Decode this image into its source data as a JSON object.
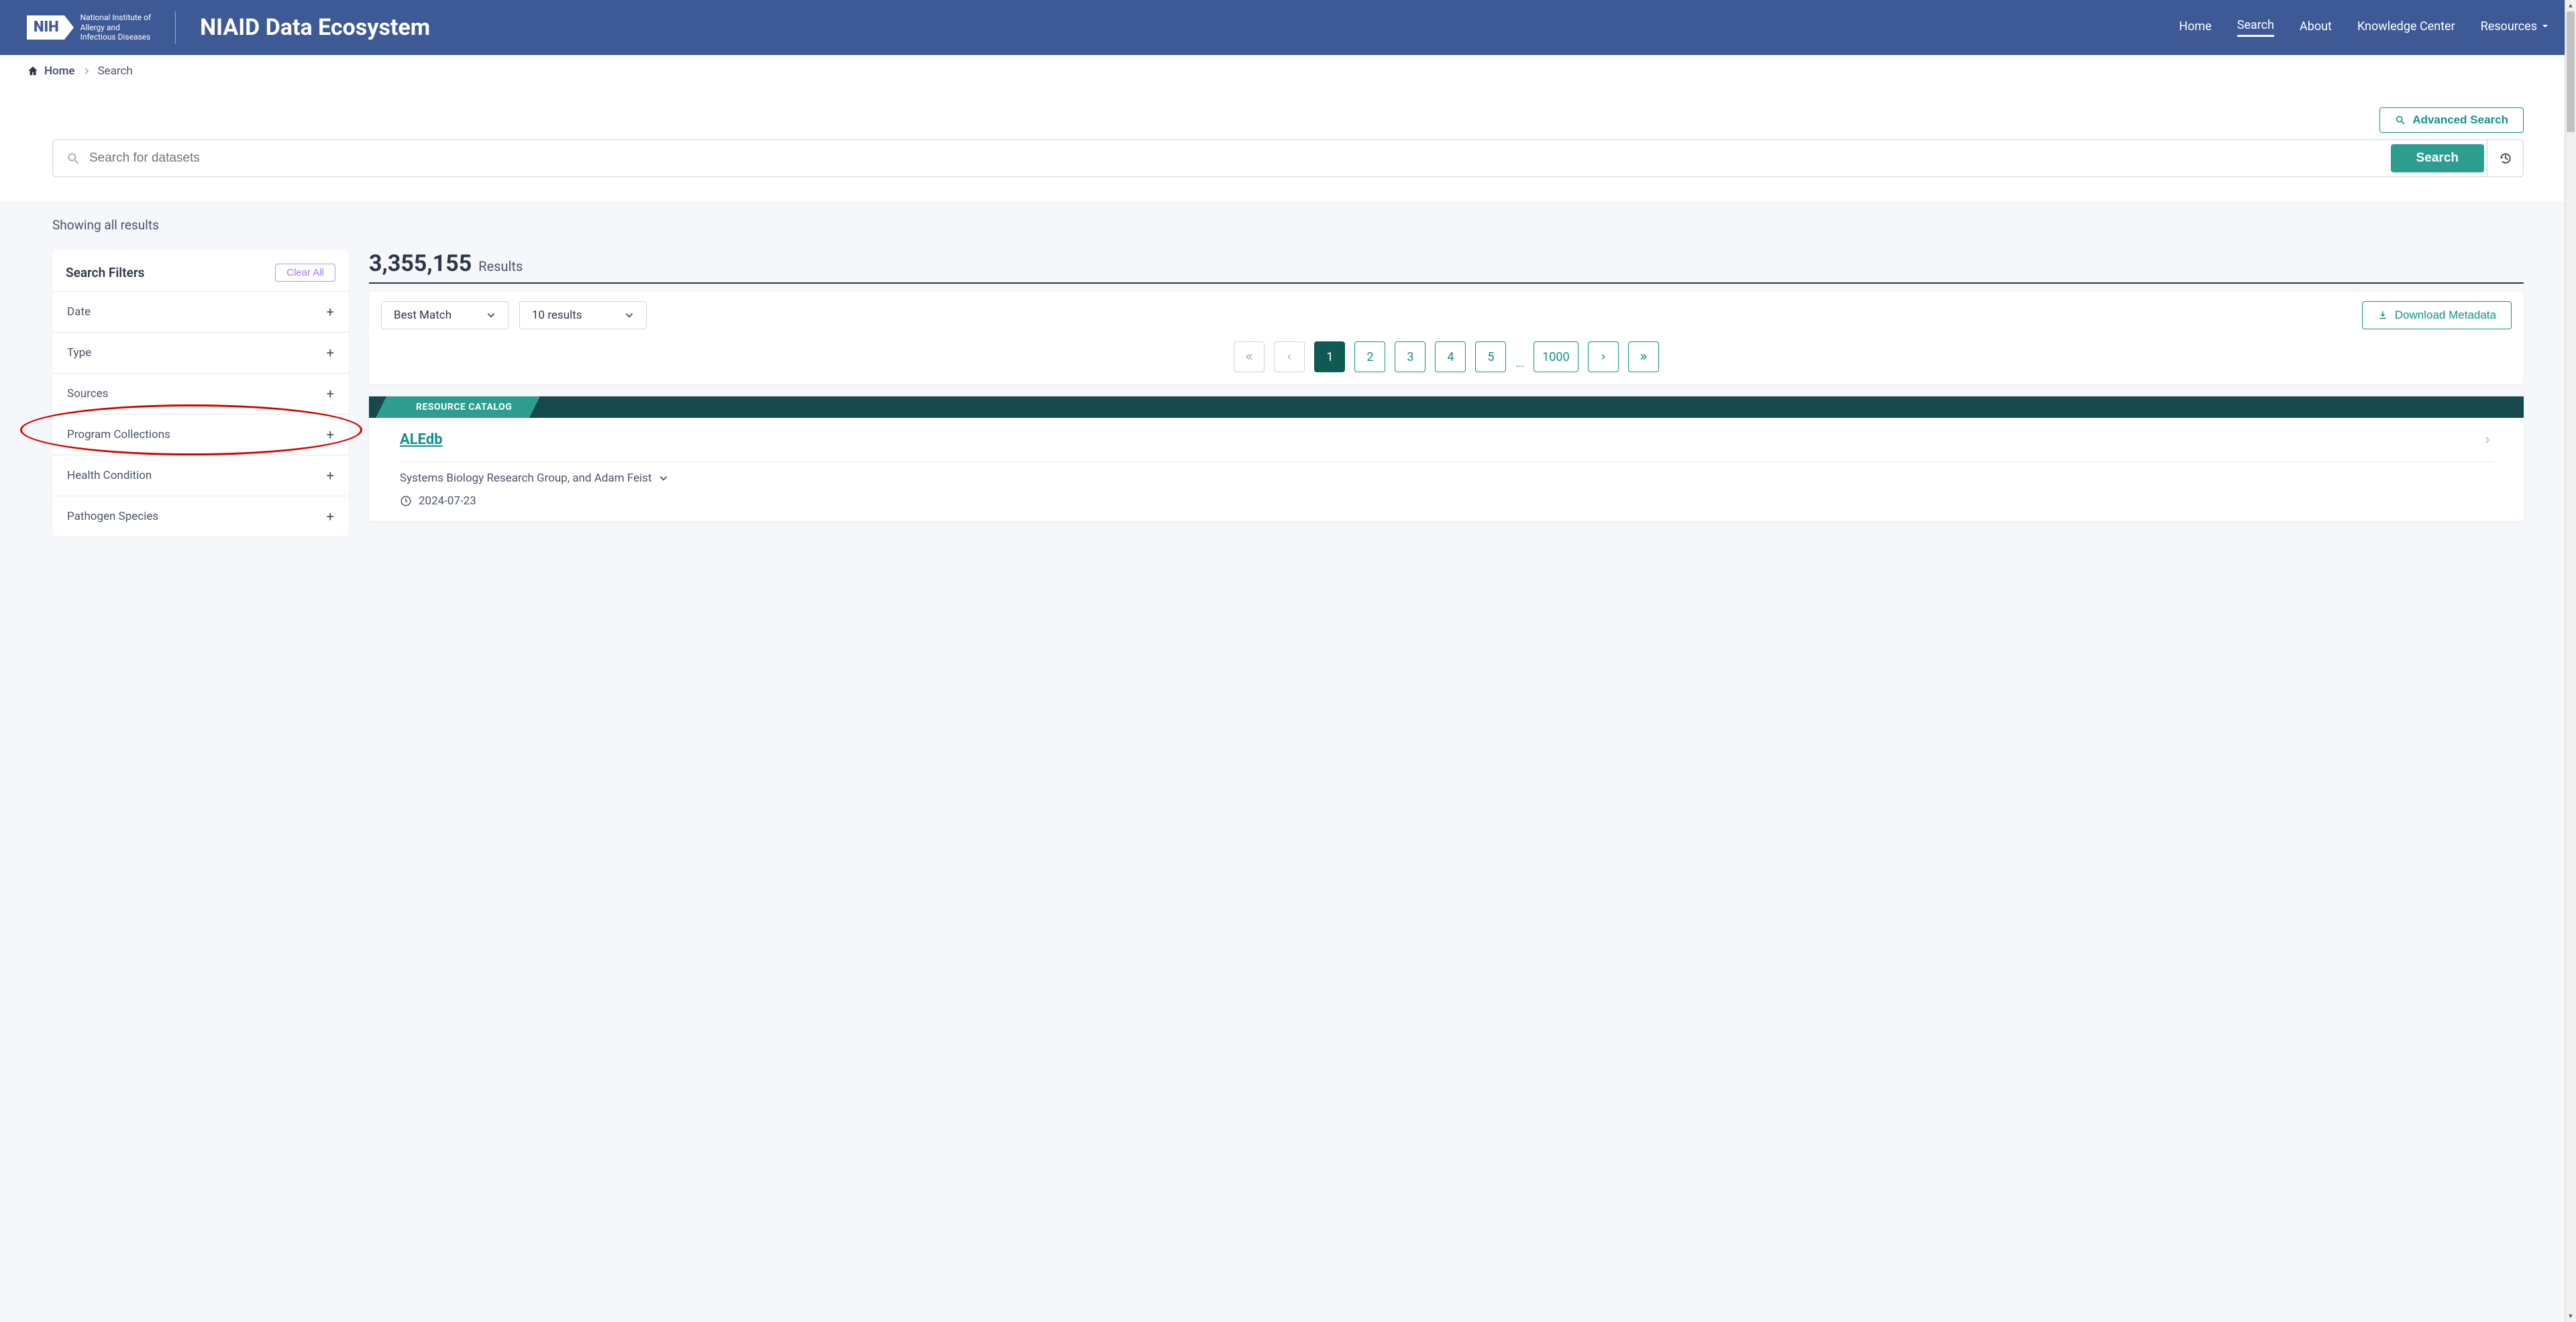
{
  "header": {
    "org_line1": "National Institute of",
    "org_line2": "Allergy and",
    "org_line3": "Infectious Diseases",
    "nih_abbrev": "NIH",
    "app_title": "NIAID Data Ecosystem",
    "nav": {
      "home": "Home",
      "search": "Search",
      "about": "About",
      "knowledge": "Knowledge Center",
      "resources": "Resources"
    }
  },
  "breadcrumb": {
    "home": "Home",
    "current": "Search"
  },
  "search_area": {
    "advanced": "Advanced Search",
    "placeholder": "Search for datasets",
    "button": "Search"
  },
  "showing": "Showing all results",
  "filters": {
    "title": "Search Filters",
    "clear": "Clear All",
    "items": [
      "Date",
      "Type",
      "Sources",
      "Program Collections",
      "Health Condition",
      "Pathogen Species"
    ]
  },
  "results": {
    "count": "3,355,155",
    "label": "Results",
    "sort": "Best Match",
    "per_page": "10 results",
    "download": "Download Metadata",
    "pages": [
      "1",
      "2",
      "3",
      "4",
      "5"
    ],
    "ellipsis": "...",
    "last_page": "1000"
  },
  "result_card": {
    "catalog_label": "RESOURCE CATALOG",
    "title": "ALEdb",
    "authors": "Systems Biology Research Group, and Adam Feist",
    "date": "2024-07-23"
  }
}
